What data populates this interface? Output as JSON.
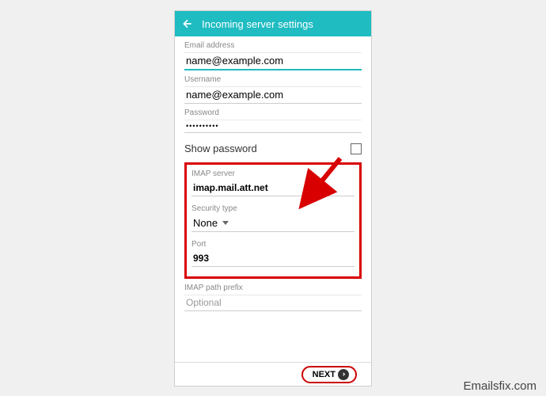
{
  "header": {
    "title": "Incoming server settings"
  },
  "fields": {
    "email": {
      "label": "Email address",
      "value": "name@example.com"
    },
    "username": {
      "label": "Username",
      "value": "name@example.com"
    },
    "password": {
      "label": "Password",
      "value": "••••••••••"
    },
    "show_password": "Show password",
    "imap_server": {
      "label": "IMAP server",
      "value": "imap.mail.att.net"
    },
    "security": {
      "label": "Security type",
      "value": "None"
    },
    "port": {
      "label": "Port",
      "value": "993"
    },
    "prefix": {
      "label": "IMAP path prefix",
      "placeholder": "Optional"
    }
  },
  "footer": {
    "next": "NEXT"
  },
  "watermark": "Emailsfix.com"
}
